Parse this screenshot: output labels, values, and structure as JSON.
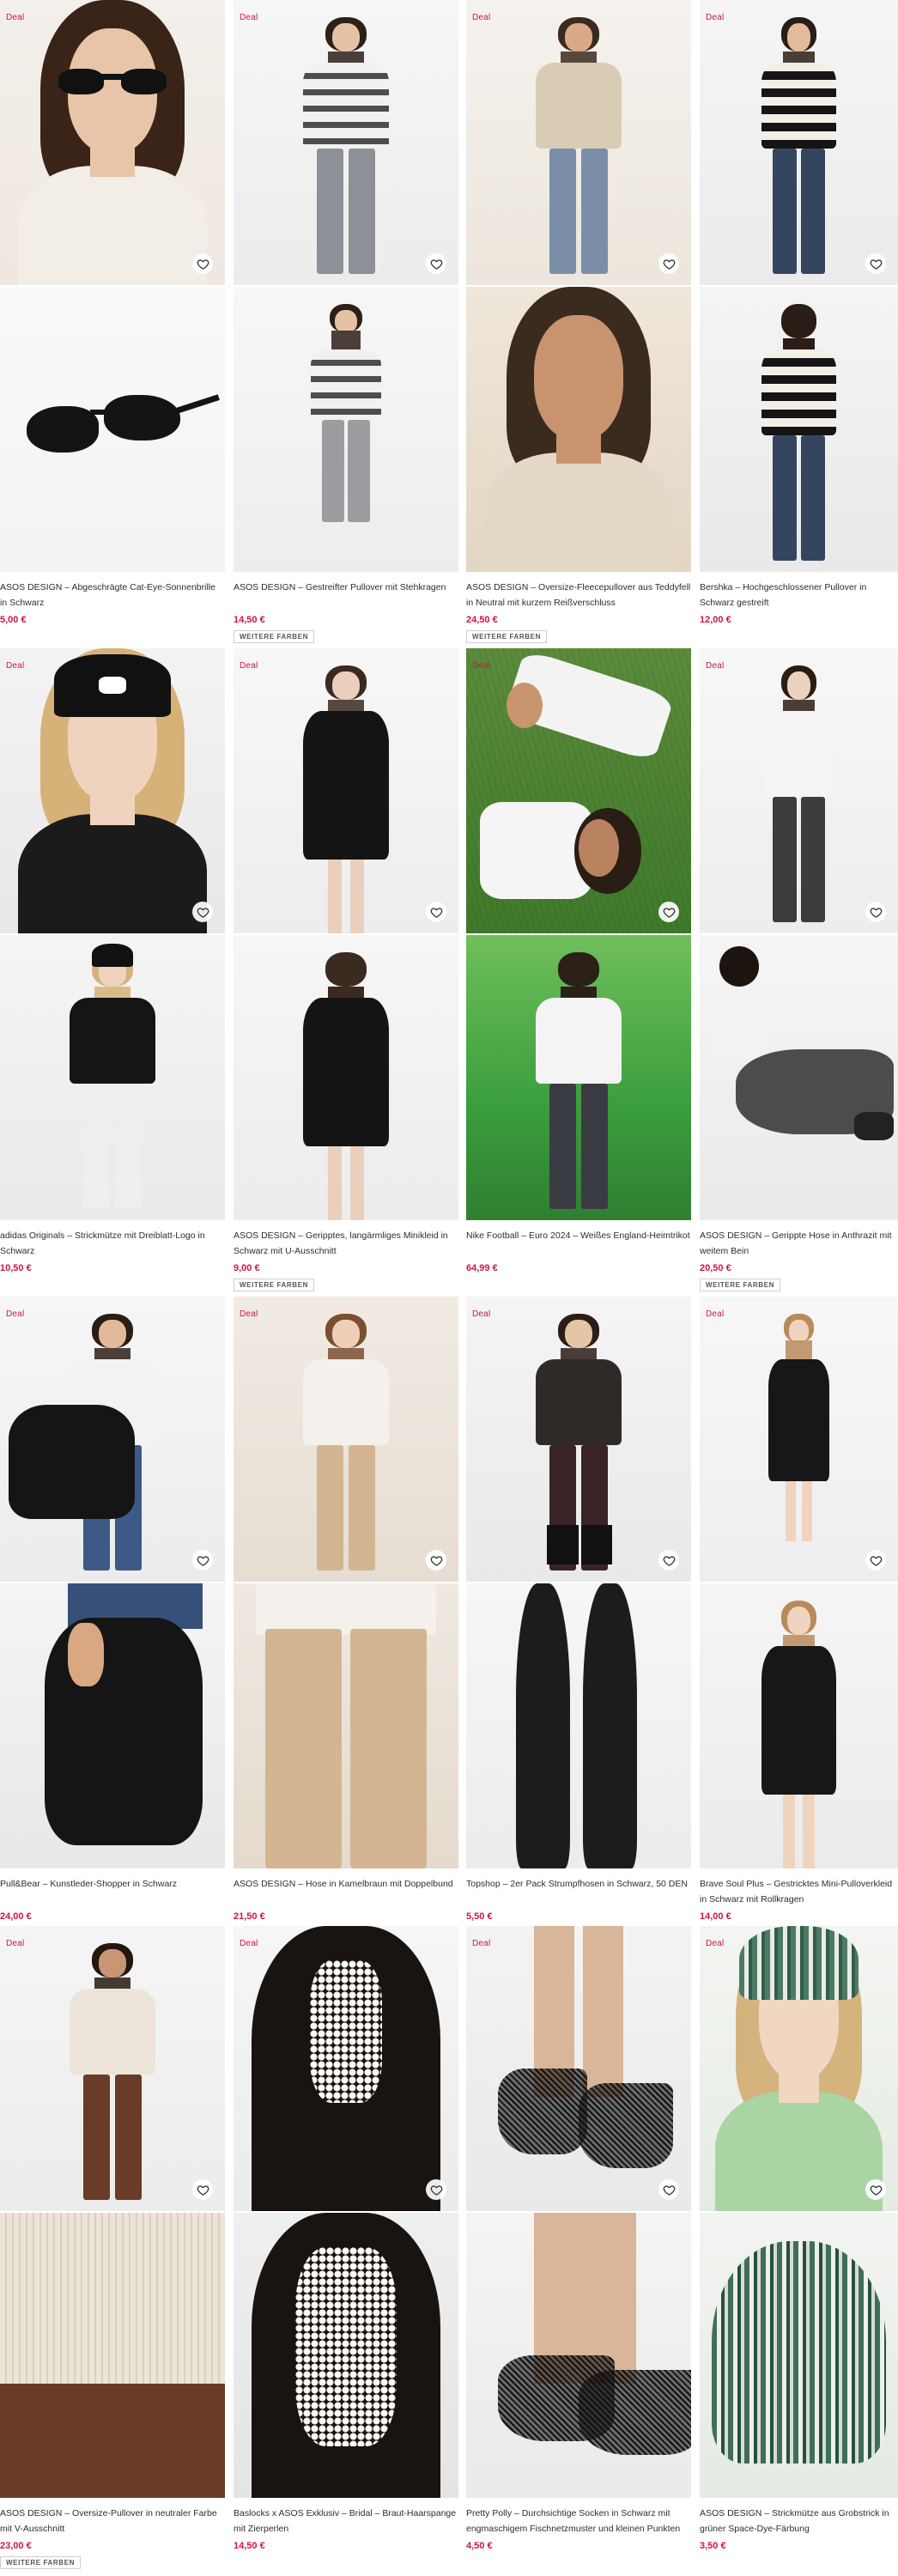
{
  "deal_label": "Deal",
  "more_colors_label": "WEITERE FARBEN",
  "products": [
    {
      "title": "ASOS DESIGN – Abgeschrägte Cat-Eye-Sonnenbrille in Schwarz",
      "price": "5,00 €",
      "more_colors": false,
      "deal": true
    },
    {
      "title": "ASOS DESIGN – Gestreifter Pullover mit Stehkragen",
      "price": "14,50 €",
      "more_colors": true,
      "deal": true
    },
    {
      "title": "ASOS DESIGN – Oversize-Fleecepullover aus Teddyfell in Neutral mit kurzem Reißverschluss",
      "price": "24,50 €",
      "more_colors": true,
      "deal": true
    },
    {
      "title": "Bershka – Hochgeschlossener Pullover in Schwarz gestreift",
      "price": "12,00 €",
      "more_colors": false,
      "deal": true
    },
    {
      "title": "adidas Originals – Strickmütze mit Dreiblatt-Logo in Schwarz",
      "price": "10,50 €",
      "more_colors": false,
      "deal": true
    },
    {
      "title": "ASOS DESIGN – Geripptes, langärmliges Minikleid in Schwarz mit U-Ausschnitt",
      "price": "9,00 €",
      "more_colors": true,
      "deal": true
    },
    {
      "title": "Nike Football – Euro 2024 – Weißes England-Heimtrikot",
      "price": "64,99 €",
      "more_colors": false,
      "deal": true
    },
    {
      "title": "ASOS DESIGN – Gerippte Hose in Anthrazit mit weitem Bein",
      "price": "20,50 €",
      "more_colors": true,
      "deal": true
    },
    {
      "title": "Pull&Bear – Kunstleder-Shopper in Schwarz",
      "price": "24,00 €",
      "more_colors": false,
      "deal": true
    },
    {
      "title": "ASOS DESIGN – Hose in Kamelbraun mit Doppelbund",
      "price": "21,50 €",
      "more_colors": false,
      "deal": true
    },
    {
      "title": "Topshop – 2er Pack Strumpfhosen in Schwarz, 50 DEN",
      "price": "5,50 €",
      "more_colors": false,
      "deal": true
    },
    {
      "title": "Brave Soul Plus – Gestricktes Mini-Pulloverkleid in Schwarz mit Rollkragen",
      "price": "14,00 €",
      "more_colors": false,
      "deal": true
    },
    {
      "title": "ASOS DESIGN – Oversize-Pullover in neutraler Farbe mit V-Ausschnitt",
      "price": "23,00 €",
      "more_colors": true,
      "deal": true
    },
    {
      "title": "Baslocks x ASOS Exklusiv – Bridal – Braut-Haarspange mit Zierperlen",
      "price": "14,50 €",
      "more_colors": false,
      "deal": true
    },
    {
      "title": "Pretty Polly – Durchsichtige Socken in Schwarz mit engmaschigem Fischnetzmuster und kleinen Punkten",
      "price": "4,50 €",
      "more_colors": false,
      "deal": true
    },
    {
      "title": "ASOS DESIGN – Strickmütze aus Grobstrick in grüner Space-Dye-Färbung",
      "price": "3,50 €",
      "more_colors": false,
      "deal": true
    }
  ],
  "colors": {
    "price": "#d01345",
    "deal": "#d01345",
    "text": "#2d2d2d"
  },
  "icons": {
    "wishlist": "heart-icon"
  }
}
